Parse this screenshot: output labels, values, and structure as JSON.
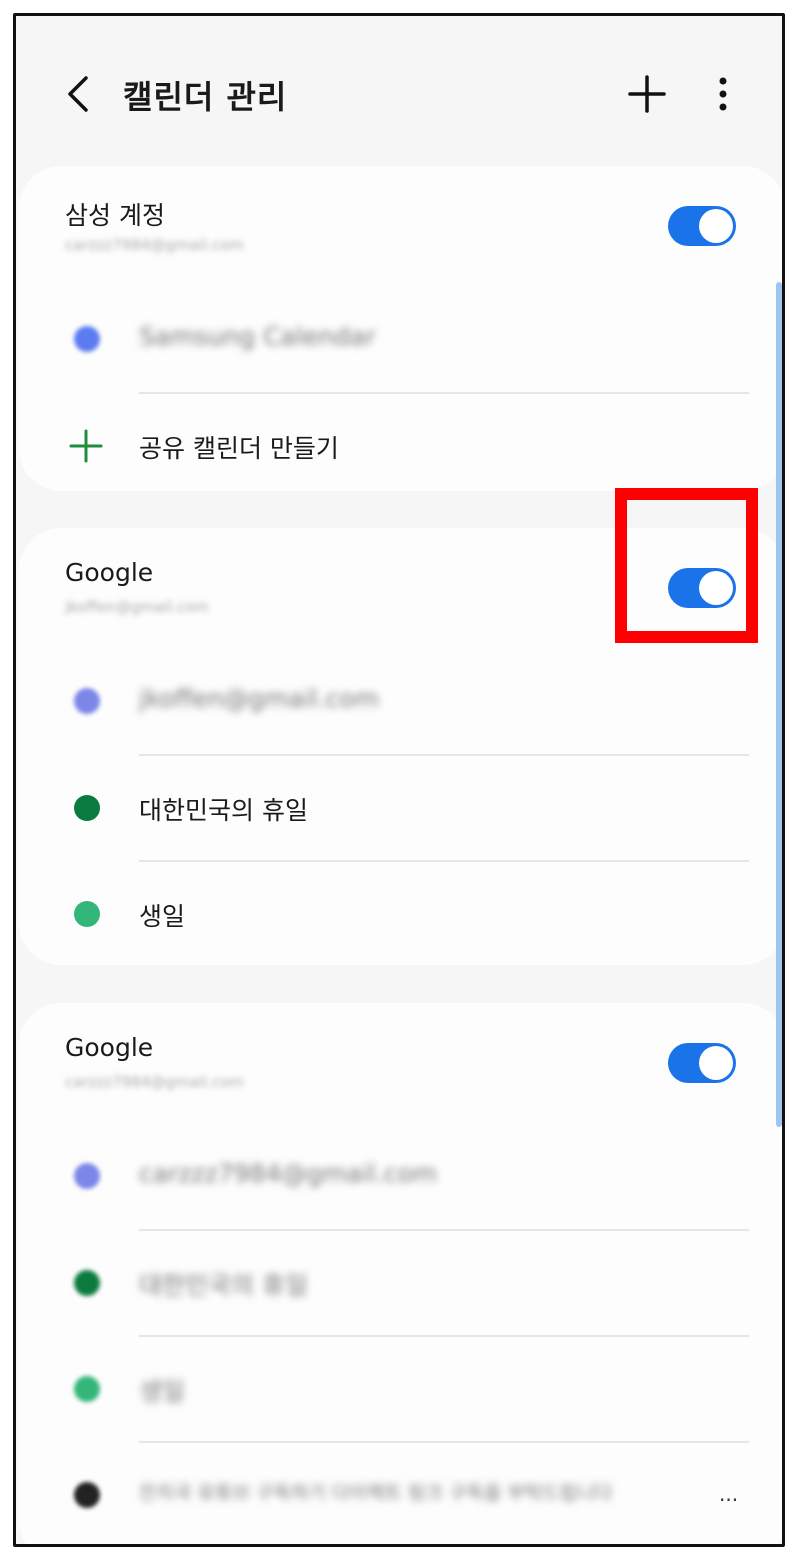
{
  "appbar": {
    "title": "캘린더 관리",
    "back_icon": "chevron-left-icon",
    "add_icon": "plus-icon",
    "more_icon": "more-vertical-icon"
  },
  "accounts": [
    {
      "name": "삼성 계정",
      "email": "carzzz7984@gmail.com",
      "enabled": true,
      "calendars": [
        {
          "label": "Samsung Calendar",
          "color": "#5b7cf0",
          "blurred": true
        }
      ],
      "create_shared_label": "공유 캘린더 만들기"
    },
    {
      "name": "Google",
      "email": "jkoffen@gmail.com",
      "enabled": true,
      "calendars": [
        {
          "label": "jkoffen@gmail.com",
          "color": "#7b86e8",
          "blurred": true
        },
        {
          "label": "대한민국의 휴일",
          "color": "#0b7a3e",
          "blurred": false
        },
        {
          "label": "생일",
          "color": "#33b679",
          "blurred": false
        }
      ]
    },
    {
      "name": "Google",
      "email": "carzzz7984@gmail.com",
      "enabled": true,
      "calendars": [
        {
          "label": "carzzz7984@gmail.com",
          "color": "#7b86e8",
          "blurred": true
        },
        {
          "label": "대한민국의 휴일",
          "color": "#0b7a3e",
          "blurred": true
        },
        {
          "label": "생일",
          "color": "#33b679",
          "blurred": true
        },
        {
          "label": "잔치국 유튜브 구독하기 다이렉트 링크 구독을 부탁드립니다",
          "color": "#222222",
          "blurred": true
        }
      ],
      "more_text": "..."
    }
  ],
  "colors": {
    "accent": "#1a73e8",
    "highlight": "#ff0000",
    "add_green": "#1e8e3e"
  }
}
